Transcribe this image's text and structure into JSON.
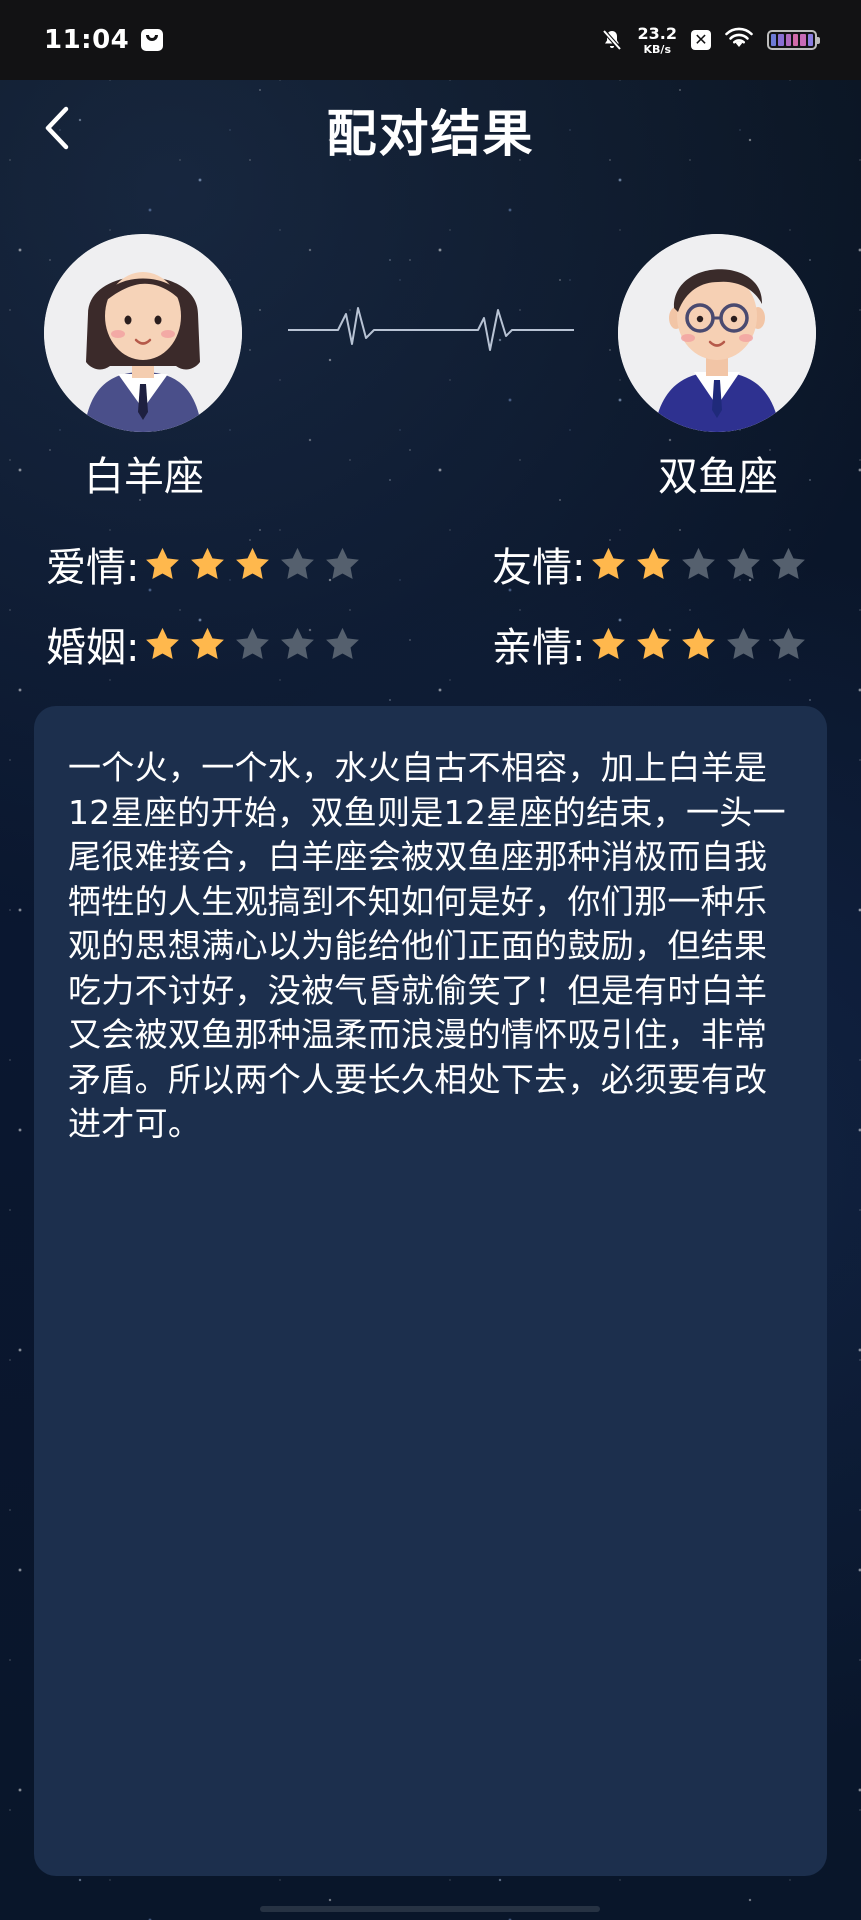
{
  "status_bar": {
    "time": "11:04",
    "net_speed_value": "23.2",
    "net_speed_unit": "KB/s",
    "battery_colors": [
      "#6e7bd6",
      "#8a6fd3",
      "#b06bbf",
      "#d06aa8",
      "#c76bb6",
      "#8b7ee0"
    ]
  },
  "header": {
    "title": "配对结果"
  },
  "pair": {
    "left_sign": "白羊座",
    "right_sign": "双鱼座"
  },
  "ratings": {
    "love": {
      "label": "爱情:",
      "score": 3,
      "max": 5
    },
    "friendship": {
      "label": "友情:",
      "score": 2,
      "max": 5
    },
    "marriage": {
      "label": "婚姻:",
      "score": 2,
      "max": 5
    },
    "family": {
      "label": "亲情:",
      "score": 3,
      "max": 5
    }
  },
  "description": "一个火，一个水，水火自古不相容，加上白羊是12星座的开始，双鱼则是12星座的结束，一头一尾很难接合，白羊座会被双鱼座那种消极而自我牺牲的人生观搞到不知如何是好，你们那一种乐观的思想满心以为能给他们正面的鼓励，但结果吃力不讨好，没被气昏就偷笑了！但是有时白羊又会被双鱼那种温柔而浪漫的情怀吸引住，非常矛盾。所以两个人要长久相处下去，必须要有改进才可。",
  "colors": {
    "star_filled": "#ffb84d",
    "star_empty": "#55606e",
    "card_bg": "#1c2f4d"
  },
  "icons": {
    "back": "chevron-left-icon",
    "left_avatar": "female-avatar-icon",
    "right_avatar": "male-avatar-icon",
    "heartbeat": "heartbeat-line-icon",
    "star": "star-icon"
  }
}
